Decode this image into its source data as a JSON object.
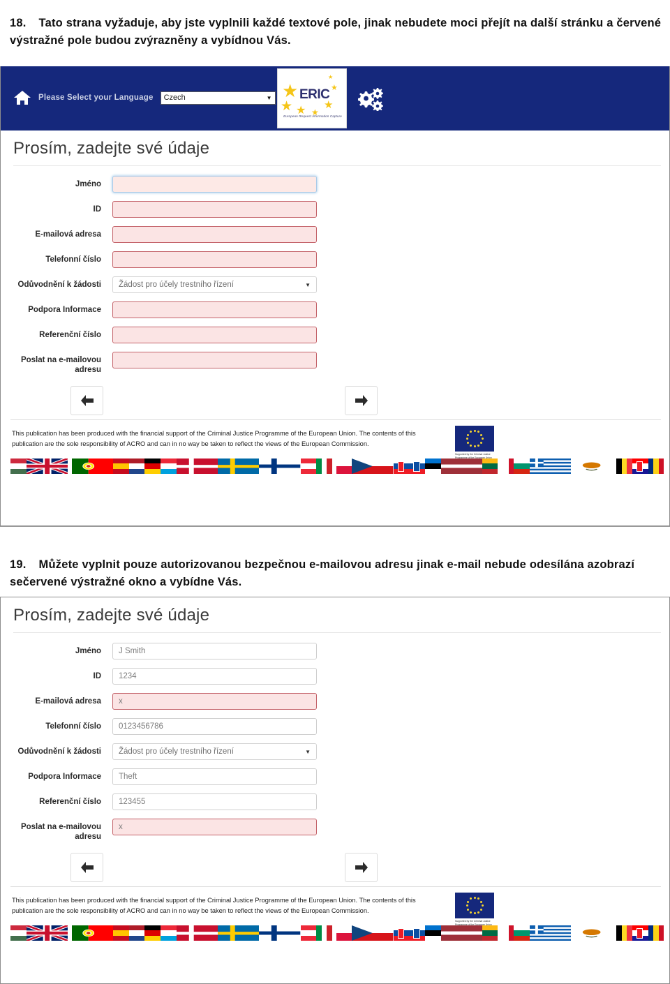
{
  "instructions": [
    {
      "number": "18.",
      "text": "Tato strana vyžaduje, aby jste vyplnili každé textové pole, jinak nebudete moci přejít na další stránku a červené výstražné pole budou zvýrazněny a vybídnou Vás."
    },
    {
      "number": "19.",
      "text": "Můžete vyplnit pouze autorizovanou bezpečnou e-mailovou adresu jinak e-mail nebude odesílána azobrazí sečervené výstražné okno a vybídne Vás."
    }
  ],
  "header": {
    "home_icon": "home-icon",
    "language_label": "Please Select your Language",
    "language_value": "Czech",
    "dropdown_arrow": "▼",
    "logo_word": "ERIC",
    "logo_tagline": "European Request Information Capture",
    "settings_icon": "gears-icon"
  },
  "form": {
    "title": "Prosím, zadejte své údaje",
    "select_arrow": "▼",
    "fields_empty": [
      {
        "label": "Jméno",
        "value": "",
        "type": "text",
        "state": "focus"
      },
      {
        "label": "ID",
        "value": "",
        "type": "text",
        "state": "error"
      },
      {
        "label": "E-mailová adresa",
        "value": "",
        "type": "text",
        "state": "error"
      },
      {
        "label": "Telefonní číslo",
        "value": "",
        "type": "text",
        "state": "error"
      },
      {
        "label": "Odůvodnění k žádosti",
        "value": "Žádost pro účely trestního řízení",
        "type": "select",
        "state": "normal"
      },
      {
        "label": "Podpora Informace",
        "value": "",
        "type": "text",
        "state": "error"
      },
      {
        "label": "Referenční číslo",
        "value": "",
        "type": "text",
        "state": "error"
      },
      {
        "label": "Poslat na e-mailovou adresu",
        "value": "",
        "type": "text",
        "state": "error"
      }
    ],
    "fields_filled": [
      {
        "label": "Jméno",
        "value": "J Smith",
        "type": "text",
        "state": "normal"
      },
      {
        "label": "ID",
        "value": "1234",
        "type": "text",
        "state": "normal"
      },
      {
        "label": "E-mailová adresa",
        "value": "x",
        "type": "text",
        "state": "error"
      },
      {
        "label": "Telefonní číslo",
        "value": "0123456786",
        "type": "text",
        "state": "normal"
      },
      {
        "label": "Odůvodnění k žádosti",
        "value": "Žádost pro účely trestního řízení",
        "type": "select",
        "state": "normal"
      },
      {
        "label": "Podpora Informace",
        "value": "Theft",
        "type": "text",
        "state": "normal"
      },
      {
        "label": "Referenční číslo",
        "value": "123455",
        "type": "text",
        "state": "normal"
      },
      {
        "label": "Poslat na e-mailovou adresu",
        "value": "x",
        "type": "text",
        "state": "error"
      }
    ],
    "nav": {
      "back_icon": "arrow-left-icon",
      "next_icon": "arrow-right-icon"
    }
  },
  "footer": {
    "disclaimer": "This publication has been produced with the financial support of the Criminal Justice Programme of the European Union. The contents of this publication are the sole responsibility of ACRO and can in no way be taken to reflect the views of the European Commission.",
    "eu_flag_icon": "eu-flag-icon",
    "eu_caption": "Supported by the Criminal Justice Programme of the European Union"
  },
  "flag_strip": [
    "Hungary",
    "United Kingdom",
    "Portugal",
    "Spain",
    "Netherlands",
    "Germany",
    "Luxembourg",
    "Denmark",
    "Sweden",
    "Finland",
    "Austria",
    "Italy",
    "Poland",
    "Czech Republic",
    "Slovakia",
    "Slovenia",
    "Estonia",
    "Latvia",
    "Lithuania",
    "Malta",
    "Bulgaria",
    "Greece",
    "Cyprus",
    "Belgium",
    "Croatia",
    "Romania"
  ],
  "colors": {
    "header_navy": "#15287c",
    "error_bg": "#fbe4e4",
    "error_border": "#c4636a",
    "logo_star": "#f5c518",
    "logo_text": "#2d2f6e"
  }
}
